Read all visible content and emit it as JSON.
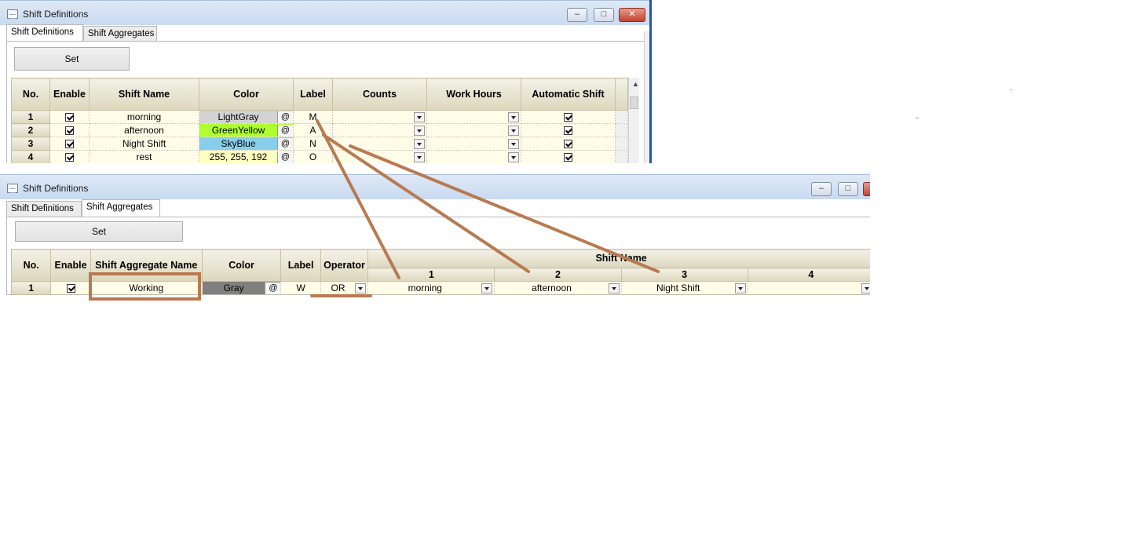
{
  "window1": {
    "title": "Shift Definitions",
    "tabs": [
      "Shift Definitions",
      "Shift Aggregates"
    ],
    "set_label": "Set",
    "headers": [
      "No.",
      "Enable",
      "Shift Name",
      "Color",
      "Label",
      "Counts",
      "Work Hours",
      "Automatic Shift"
    ],
    "rows": [
      {
        "no": "1",
        "name": "morning",
        "color": "LightGray",
        "color_hex": "#d3d3d3",
        "label": "M"
      },
      {
        "no": "2",
        "name": "afternoon",
        "color": "GreenYellow",
        "color_hex": "#adff2f",
        "label": "A"
      },
      {
        "no": "3",
        "name": "Night Shift",
        "color": "SkyBlue",
        "color_hex": "#87ceeb",
        "label": "N"
      },
      {
        "no": "4",
        "name": "rest",
        "color": "255, 255, 192",
        "color_hex": "#ffffc0",
        "label": "O"
      }
    ],
    "color_button": "@"
  },
  "window2": {
    "title": "Shift Definitions",
    "tabs": [
      "Shift Definitions",
      "Shift Aggregates"
    ],
    "set_label": "Set",
    "headers": {
      "no": "No.",
      "enable": "Enable",
      "agg_name": "Shift Aggregate Name",
      "color": "Color",
      "label": "Label",
      "operator": "Operator",
      "shift_name": "Shift Name",
      "sub": [
        "1",
        "2",
        "3",
        "4"
      ]
    },
    "row": {
      "no": "1",
      "name": "Working",
      "color": "Gray",
      "color_hex": "#808080",
      "label": "W",
      "operator": "OR",
      "shifts": [
        "morning",
        "afternoon",
        "Night Shift",
        ""
      ]
    },
    "color_button": "@"
  },
  "annotation_color": "#b87a52"
}
